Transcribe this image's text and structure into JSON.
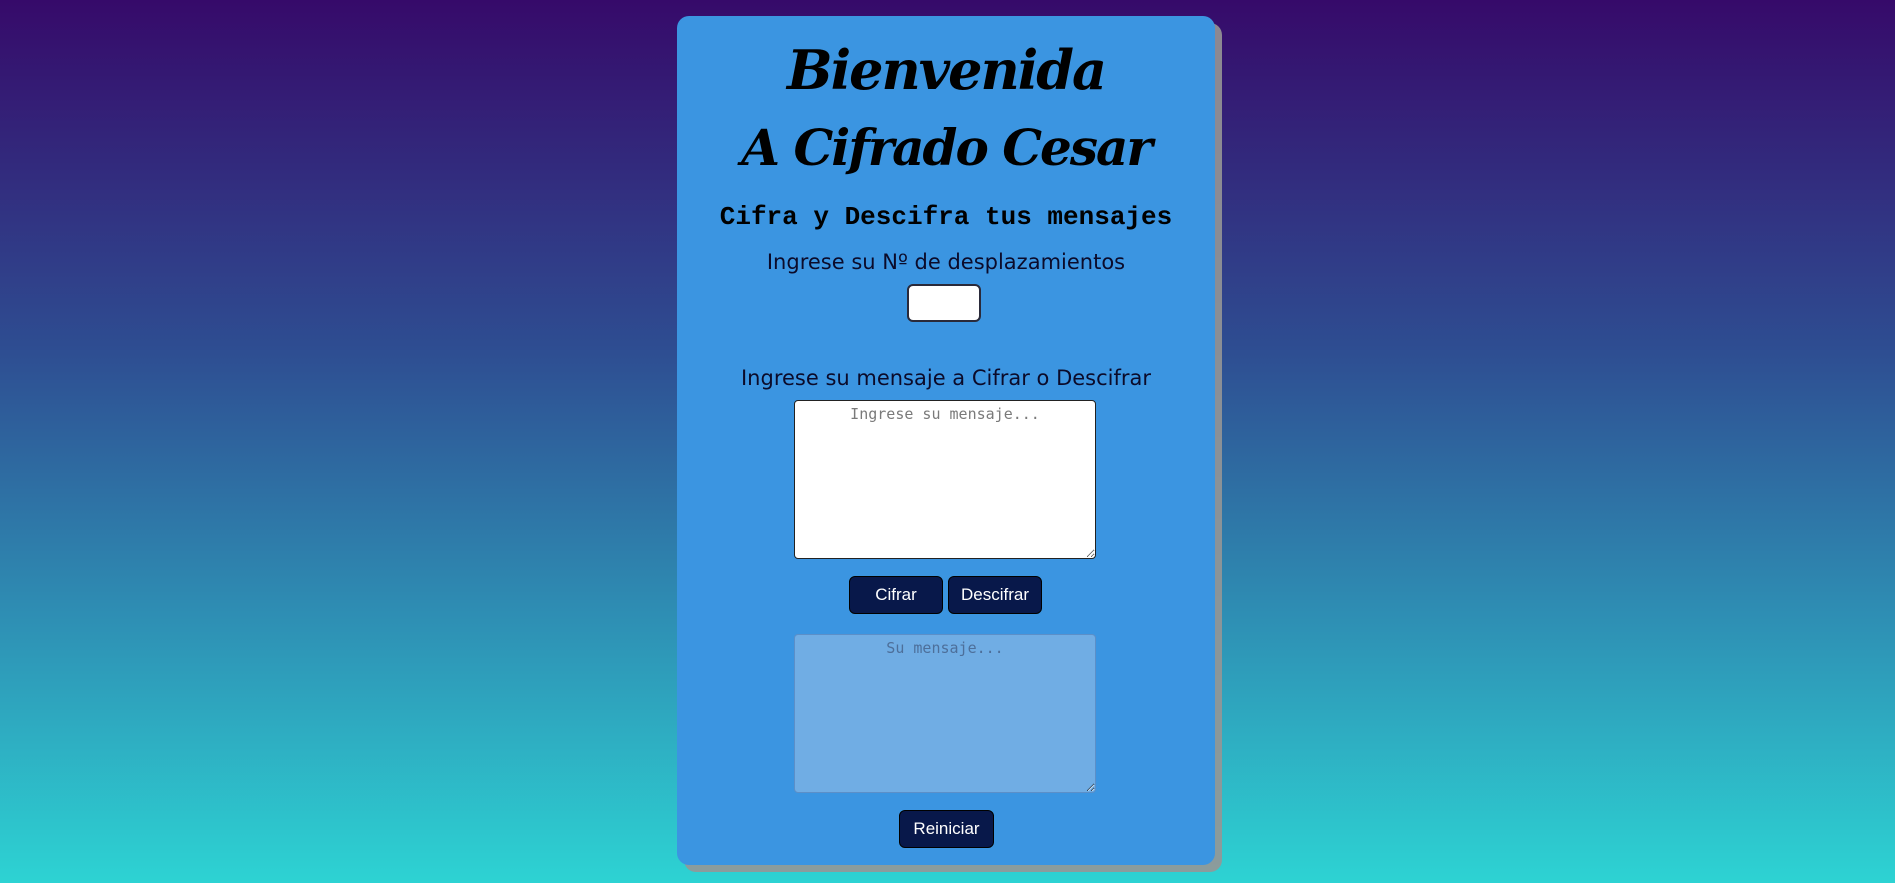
{
  "header": {
    "title": "Bienvenida",
    "subtitle": "A Cifrado Cesar",
    "tagline": "Cifra y Descifra tus mensajes"
  },
  "form": {
    "shift_label": "Ingrese su Nº de desplazamientos",
    "shift_value": "",
    "message_label": "Ingrese su mensaje a Cifrar o Descifrar",
    "message_placeholder": "Ingrese su mensaje...",
    "result_placeholder": "Su mensaje..."
  },
  "buttons": {
    "encrypt": "Cifrar",
    "decrypt": "Descifrar",
    "reset": "Reiniciar"
  },
  "colors": {
    "card_bg": "#3b95e1",
    "button_bg": "#08184a",
    "gradient_top": "#360a6a",
    "gradient_bottom": "#2dd3d3"
  }
}
